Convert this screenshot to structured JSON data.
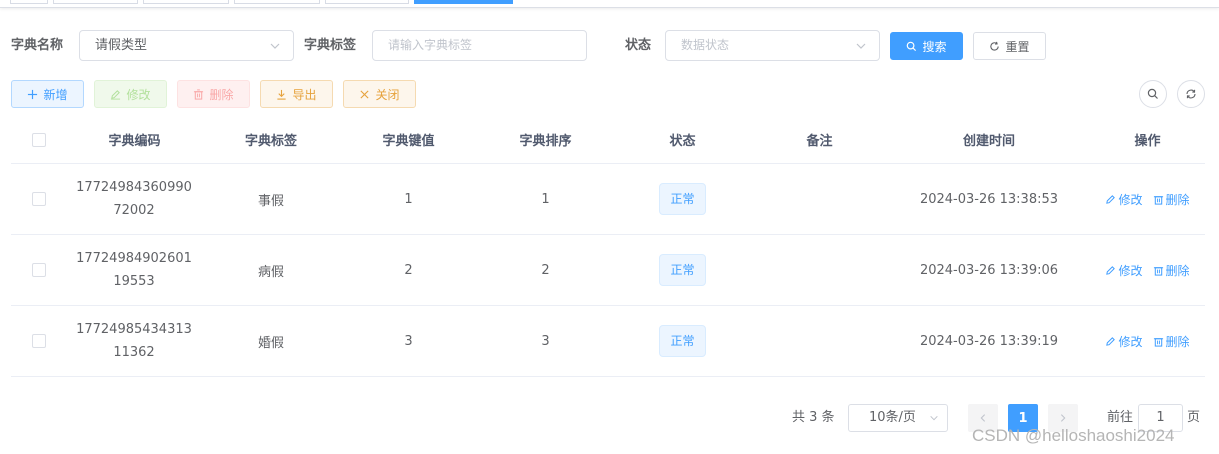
{
  "search": {
    "dict_name_label": "字典名称",
    "dict_name_value": "请假类型",
    "dict_label_label": "字典标签",
    "dict_label_placeholder": "请输入字典标签",
    "status_label": "状态",
    "status_placeholder": "数据状态",
    "search_button": "搜索",
    "reset_button": "重置"
  },
  "toolbar": {
    "add": "新增",
    "edit": "修改",
    "delete": "删除",
    "export": "导出",
    "close": "关闭"
  },
  "table": {
    "headers": {
      "code": "字典编码",
      "label": "字典标签",
      "value": "字典键值",
      "sort": "字典排序",
      "status": "状态",
      "remark": "备注",
      "created": "创建时间",
      "ops": "操作"
    },
    "rows": [
      {
        "code": "1772498436099072002",
        "label": "事假",
        "value": "1",
        "sort": "1",
        "status": "正常",
        "remark": "",
        "created": "2024-03-26 13:38:53"
      },
      {
        "code": "1772498490260119553",
        "label": "病假",
        "value": "2",
        "sort": "2",
        "status": "正常",
        "remark": "",
        "created": "2024-03-26 13:39:06"
      },
      {
        "code": "1772498543431311362",
        "label": "婚假",
        "value": "3",
        "sort": "3",
        "status": "正常",
        "remark": "",
        "created": "2024-03-26 13:39:19"
      }
    ],
    "op_edit": "修改",
    "op_delete": "删除"
  },
  "pagination": {
    "total": "共 3 条",
    "page_size": "10条/页",
    "current_page": "1",
    "goto_prefix": "前往",
    "goto_value": "1",
    "goto_suffix": "页"
  },
  "watermark": "CSDN @helloshaoshi2024",
  "colors": {
    "primary": "#409eff",
    "success_light": "#f0f9eb",
    "danger_light": "#fef0f0",
    "warning": "#e6a23c"
  }
}
